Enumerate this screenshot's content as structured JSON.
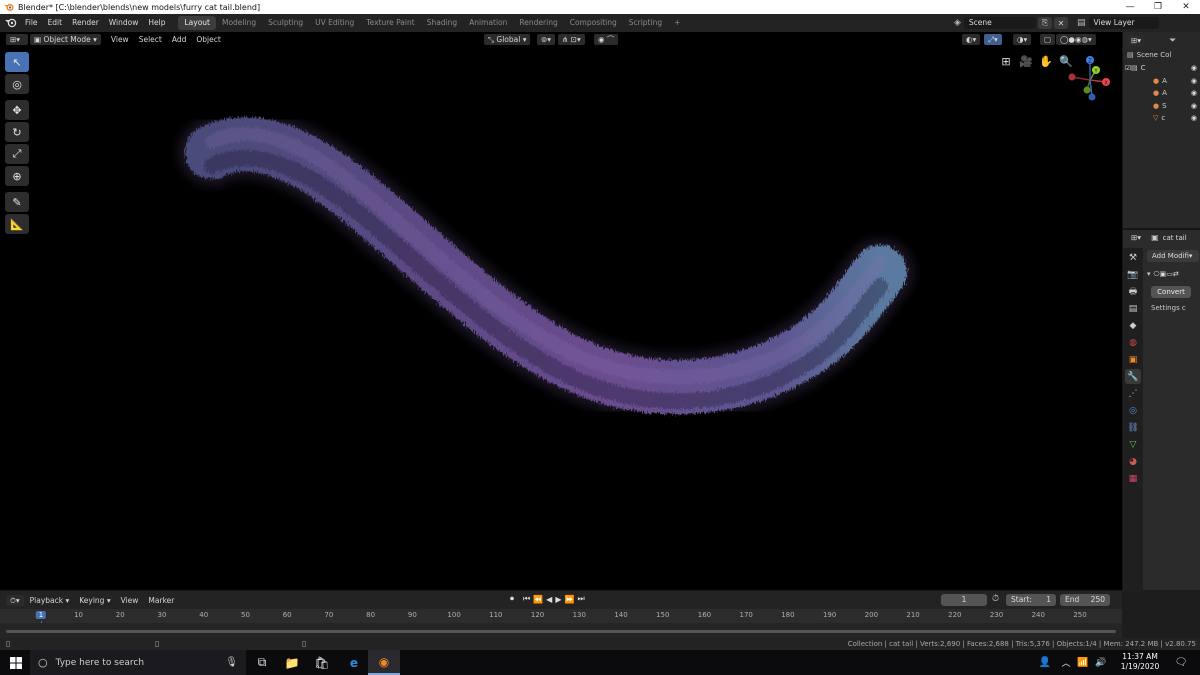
{
  "window": {
    "title": "Blender* [C:\\blender\\blends\\new models\\furry cat tail.blend]",
    "controls": [
      "—",
      "❐",
      "✕"
    ]
  },
  "menu": [
    "File",
    "Edit",
    "Render",
    "Window",
    "Help"
  ],
  "workspaces": [
    "Layout",
    "Modeling",
    "Sculpting",
    "UV Editing",
    "Texture Paint",
    "Shading",
    "Animation",
    "Rendering",
    "Compositing",
    "Scripting"
  ],
  "workspace_add": "+",
  "scene": {
    "label": "Scene",
    "view_layer": "View Layer"
  },
  "viewport": {
    "mode": "Object Mode",
    "menus": [
      "View",
      "Select",
      "Add",
      "Object"
    ],
    "orientation": "Global",
    "gizmo_axes": {
      "x": "X",
      "y": "Y",
      "z": "Z"
    }
  },
  "tools": [
    {
      "name": "select-box-tool",
      "glyph": "↖",
      "active": true
    },
    {
      "name": "cursor-tool",
      "glyph": "◎",
      "active": false
    },
    {
      "name": "move-tool",
      "glyph": "✥",
      "active": false
    },
    {
      "name": "rotate-tool",
      "glyph": "↻",
      "active": false
    },
    {
      "name": "scale-tool",
      "glyph": "⤢",
      "active": false
    },
    {
      "name": "transform-tool",
      "glyph": "⊕",
      "active": false
    },
    {
      "name": "annotate-tool",
      "glyph": "✎",
      "active": false
    },
    {
      "name": "measure-tool",
      "glyph": "📐",
      "active": false
    }
  ],
  "outliner": {
    "root": "Scene Col",
    "rows": [
      {
        "label": "C",
        "icon": "collection-icon",
        "color": "#cfcfcf"
      },
      {
        "label": "A",
        "icon": "object-icon",
        "color": "#e0894a"
      },
      {
        "label": "A",
        "icon": "object-icon",
        "color": "#e0894a"
      },
      {
        "label": "S",
        "icon": "object-icon",
        "color": "#e0894a"
      },
      {
        "label": "c",
        "icon": "mesh-icon",
        "color": "#e0894a"
      }
    ]
  },
  "properties": {
    "object_name": "cat tail",
    "add_modifier": "Add Modifi",
    "convert": "Convert",
    "settings": "Settings c"
  },
  "timeline": {
    "menus": [
      "Playback",
      "Keying",
      "View",
      "Marker"
    ],
    "current_frame": "1",
    "start_label": "Start:",
    "start": "1",
    "end_label": "End",
    "end": "250",
    "ticks": [
      "1",
      "10",
      "20",
      "30",
      "40",
      "50",
      "60",
      "70",
      "80",
      "90",
      "100",
      "110",
      "120",
      "130",
      "140",
      "150",
      "160",
      "170",
      "180",
      "190",
      "200",
      "210",
      "220",
      "230",
      "240",
      "250"
    ]
  },
  "status": {
    "text": "Collection | cat tail | Verts:2,690 | Faces:2,688 | Tris:5,376 | Objects:1/4 | Mem: 247.2 MB | v2.80.75"
  },
  "taskbar": {
    "search_placeholder": "Type here to search",
    "time": "11:37 AM",
    "date": "1/19/2020"
  },
  "colors": {
    "accent": "#4772b3",
    "viewport_bg": "#000000",
    "tail_purple": "#6a4d8a",
    "tail_blue": "#5a6b96"
  }
}
